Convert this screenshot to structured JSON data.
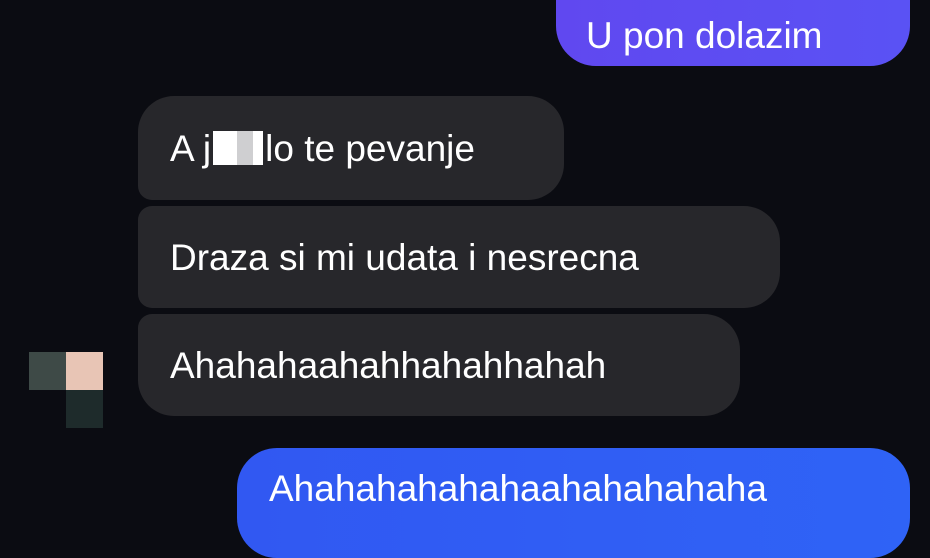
{
  "colors": {
    "background": "#0b0c12",
    "incoming_bubble": "#27272b",
    "outgoing_bubble_top": "#5a52f4",
    "outgoing_bubble_bottom": "#3158f2",
    "text": "#ffffff"
  },
  "messages": [
    {
      "direction": "outgoing",
      "text": "U pon dolazim"
    },
    {
      "direction": "incoming",
      "text_before": "A j",
      "text_after": "lo te pevanje",
      "censored": true
    },
    {
      "direction": "incoming",
      "text": "Draza si mi udata i nesrecna"
    },
    {
      "direction": "incoming",
      "text": "Ahahahaahahhahahhahah"
    },
    {
      "direction": "outgoing",
      "text": "Ahahahahahahaahahahahaha"
    }
  ],
  "sender_avatar": {
    "icon": "pixelated-avatar-icon"
  }
}
